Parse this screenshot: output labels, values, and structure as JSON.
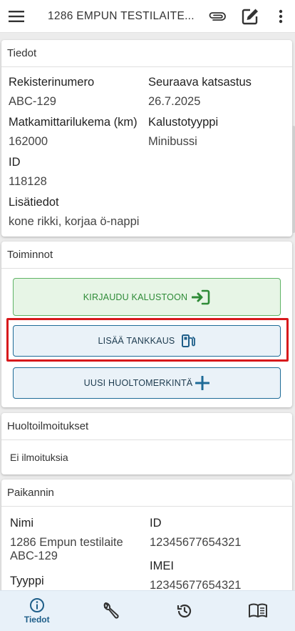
{
  "header": {
    "title": "1286 EMPUN TESTILAITE...",
    "icons": [
      "menu-icon",
      "paperclip-icon",
      "edit-icon",
      "more-vert-icon"
    ]
  },
  "details": {
    "header": "Tiedot",
    "registration_label": "Rekisterinumero",
    "registration_value": "ABC-129",
    "next_inspection_label": "Seuraava katsastus",
    "next_inspection_value": "26.7.2025",
    "odometer_label": "Matkamittarilukema (km)",
    "odometer_value": "162000",
    "equipment_type_label": "Kalustotyyppi",
    "equipment_type_value": "Minibussi",
    "id_label": "ID",
    "id_value": "118128",
    "extra_label": "Lisätiedot",
    "extra_value": "kone rikki, korjaa ö-nappi"
  },
  "actions": {
    "header": "Toiminnot",
    "login_label": "KIRJAUDU KALUSTOON",
    "refuel_label": "LISÄÄ TANKKAUS",
    "maintenance_label": "UUSI HUOLTOMERKINTÄ"
  },
  "notices": {
    "header": "Huoltoilmoitukset",
    "empty_text": "Ei ilmoituksia"
  },
  "locator": {
    "header": "Paikannin",
    "name_label": "Nimi",
    "name_value_line1": "1286 Empun testilaite",
    "name_value_line2": "ABC-129",
    "id_label": "ID",
    "id_value": "12345677654321",
    "imei_label": "IMEI",
    "imei_value": "12345677654321",
    "type_label": "Tyyppi"
  },
  "bottom_nav": {
    "details_label": "Tiedot"
  },
  "colors": {
    "accent": "#1e5e89",
    "green": "#2e8b37",
    "highlight": "#d7191c"
  }
}
